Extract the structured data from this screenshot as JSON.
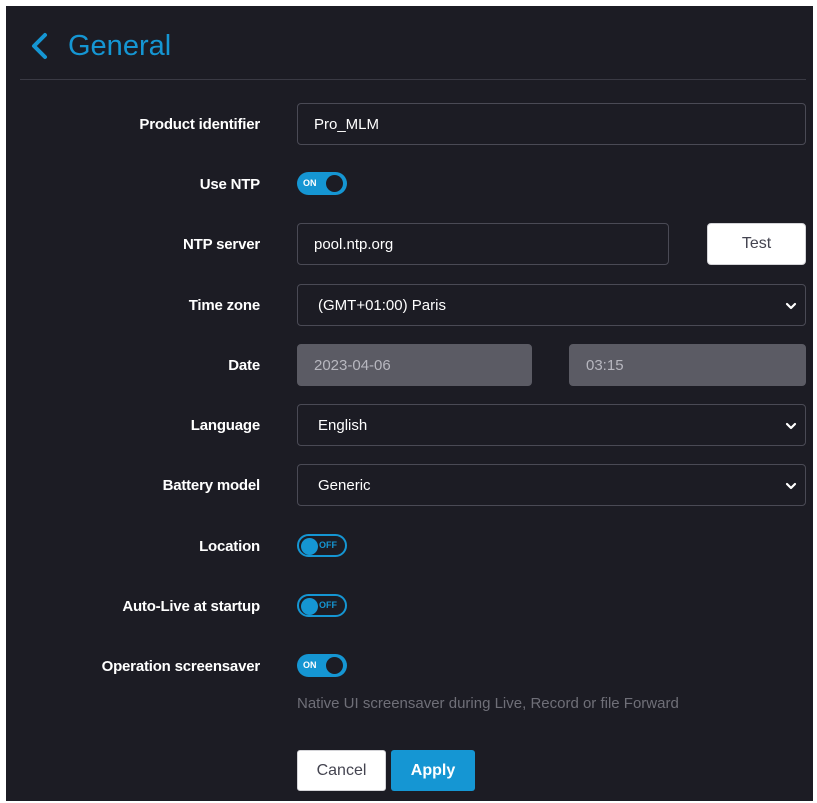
{
  "header": {
    "title": "General",
    "back_icon": "chevron-left-icon"
  },
  "colors": {
    "accent": "#1596d3",
    "background": "#1c1c24",
    "disabled": "#5b5b64"
  },
  "form": {
    "product_identifier": {
      "label": "Product identifier",
      "value": "Pro_MLM"
    },
    "use_ntp": {
      "label": "Use NTP",
      "state": "ON"
    },
    "ntp_server": {
      "label": "NTP server",
      "value": "pool.ntp.org",
      "test_label": "Test"
    },
    "time_zone": {
      "label": "Time zone",
      "value": "(GMT+01:00) Paris"
    },
    "date": {
      "label": "Date",
      "date_value": "2023-04-06",
      "time_value": "03:15"
    },
    "language": {
      "label": "Language",
      "value": "English"
    },
    "battery_model": {
      "label": "Battery model",
      "value": "Generic"
    },
    "location": {
      "label": "Location",
      "state": "OFF"
    },
    "auto_live": {
      "label": "Auto-Live at startup",
      "state": "OFF"
    },
    "operation_screensaver": {
      "label": "Operation screensaver",
      "state": "ON",
      "hint": "Native UI screensaver during Live, Record or file Forward"
    }
  },
  "actions": {
    "cancel_label": "Cancel",
    "apply_label": "Apply"
  }
}
